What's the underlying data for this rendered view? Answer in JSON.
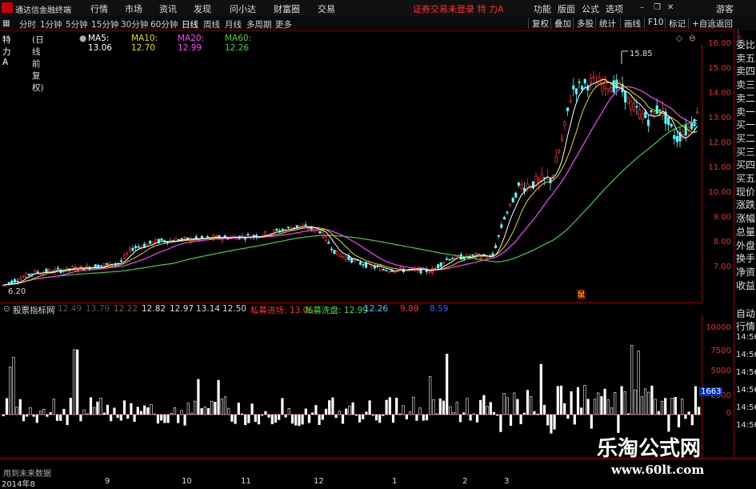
{
  "menubar": {
    "app_name": "通达信金融终端",
    "items": [
      "行情",
      "市场",
      "资讯",
      "发现",
      "问小达",
      "财富圈",
      "交易"
    ],
    "notice": "证券交易未登录 特 力A",
    "right_items": [
      "功能",
      "版面",
      "公式",
      "选项"
    ],
    "guest": "游客"
  },
  "toolbar": {
    "periods": [
      "分时",
      "1分钟",
      "5分钟",
      "15分钟",
      "30分钟",
      "60分钟",
      "日线",
      "周线",
      "月线",
      "多周期",
      "更多"
    ],
    "active_period": "日线",
    "buttons": [
      "复权",
      "叠加",
      "多股",
      "统计",
      "画线",
      "F10",
      "标记",
      "+自选",
      "返回"
    ]
  },
  "infoline": {
    "stock": "特 力A",
    "mode": "(日线 前复权)",
    "ma5": "MA5: 13.06",
    "ma10": "MA10: 12.70",
    "ma20": "MA20: 12.99",
    "ma60": "MA60: 12.26"
  },
  "main_chart": {
    "high_label": "15.85",
    "low_label": "6.20",
    "y_ticks": [
      "16.00",
      "15.00",
      "14.00",
      "13.00",
      "12.00",
      "11.00",
      "10.00",
      "9.00",
      "8.00",
      "7.00"
    ],
    "marker": "鼠"
  },
  "right_panel": {
    "top_letters": "L\nR",
    "items": [
      "委比",
      "卖五",
      "卖四",
      "卖三",
      "卖二",
      "卖一",
      "买一",
      "买二",
      "买三",
      "买四",
      "买五",
      "现价",
      "涨跌",
      "涨幅",
      "总量",
      "外盘",
      "换手",
      "净资",
      "收益"
    ],
    "sub_items": [
      "自动",
      "行情"
    ]
  },
  "indicator_bar": {
    "name": "股票指标网",
    "faded": [
      "12.49",
      "13.79",
      "12.22"
    ],
    "vals": [
      "12.82",
      "12.97",
      "13.14",
      "12.50"
    ],
    "label1": "私募进场: 13.06",
    "label2": "私募洗盘: 12.99",
    "v3": "12.26",
    "v4": "9.89",
    "v5": "8.59"
  },
  "sub_chart": {
    "y_ticks": [
      "10000",
      "7500",
      "5000",
      "2500",
      "0"
    ],
    "current_value": "1663",
    "right_times": [
      "14:56",
      "14:56",
      "14:56",
      "14:56",
      "14:56",
      "14:56"
    ]
  },
  "dates": [
    "2014年8",
    "9",
    "10",
    "11",
    "12",
    "1",
    "2",
    "3"
  ],
  "future_text": "用到未来数据",
  "watermark": {
    "cn": "乐淘公式网",
    "url": "www.60lt.com"
  },
  "colors": {
    "up": "#ff3232",
    "down": "#54ffff",
    "ma5": "#ffffff",
    "ma10": "#e0e000",
    "ma20": "#ff40ff",
    "ma60": "#40d040",
    "axis": "#a00000"
  }
}
